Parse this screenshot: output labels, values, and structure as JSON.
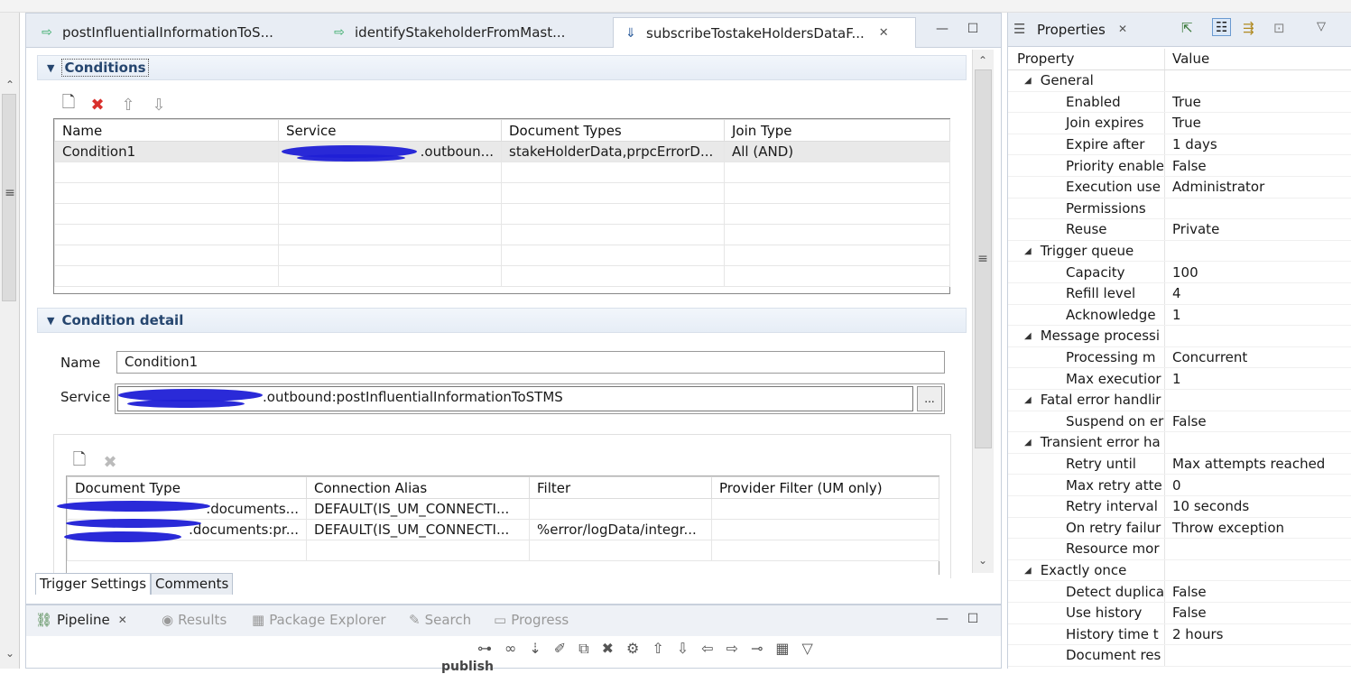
{
  "editor": {
    "tabs": [
      {
        "label": "postInfluentialInformationToS...",
        "icon": "service-arrow-icon"
      },
      {
        "label": "identifyStakeholderFromMast...",
        "icon": "service-arrow-icon"
      },
      {
        "label": "subscribeTostakeHoldersDataF...",
        "icon": "trigger-icon",
        "active": true,
        "close": "✕"
      }
    ],
    "conditions": {
      "title": "Conditions",
      "columns": [
        "Name",
        "Service",
        "Document Types",
        "Join Type"
      ],
      "rows": [
        {
          "name": "Condition1",
          "service": ".outboun...",
          "doc_types": "stakeHolderData,prpcErrorD...",
          "join": "All (AND)"
        }
      ]
    },
    "detail": {
      "title": "Condition detail",
      "name_label": "Name",
      "name_value": "Condition1",
      "service_label": "Service",
      "service_value": ".outbound:postInfluentialInformationToSTMS",
      "browse_label": "...",
      "columns": [
        "Document Type",
        "Connection Alias",
        "Filter",
        "Provider Filter (UM only)"
      ],
      "rows": [
        {
          "doc": ".documents...",
          "alias": "DEFAULT(IS_UM_CONNECTI...",
          "filter": "",
          "provider": ""
        },
        {
          "doc": ".documents:pr...",
          "alias": "DEFAULT(IS_UM_CONNECTI...",
          "filter": "%error/logData/integr...",
          "provider": ""
        }
      ]
    },
    "bottom_tabs": [
      "Trigger Settings",
      "Comments"
    ]
  },
  "pipeline": {
    "tabs": [
      {
        "label": "Pipeline",
        "active": true,
        "close": "✕"
      },
      {
        "label": "Results"
      },
      {
        "label": "Package Explorer"
      },
      {
        "label": "Search"
      },
      {
        "label": "Progress"
      }
    ],
    "partial_text": "publish"
  },
  "properties": {
    "title": "Properties",
    "close": "✕",
    "header": {
      "key": "Property",
      "value": "Value"
    },
    "rows": [
      {
        "type": "cat",
        "key": "General",
        "value": ""
      },
      {
        "type": "item",
        "key": "Enabled",
        "value": "True"
      },
      {
        "type": "item",
        "key": "Join expires",
        "value": "True"
      },
      {
        "type": "item",
        "key": "Expire after",
        "value": "1 days"
      },
      {
        "type": "item",
        "key": "Priority enable",
        "value": "False"
      },
      {
        "type": "item",
        "key": "Execution use",
        "value": "Administrator"
      },
      {
        "type": "item",
        "key": "Permissions",
        "value": ""
      },
      {
        "type": "item",
        "key": "Reuse",
        "value": "Private"
      },
      {
        "type": "cat",
        "key": "Trigger queue",
        "value": ""
      },
      {
        "type": "item",
        "key": "Capacity",
        "value": "100"
      },
      {
        "type": "item",
        "key": "Refill level",
        "value": "4"
      },
      {
        "type": "item",
        "key": "Acknowledge",
        "value": "1"
      },
      {
        "type": "cat",
        "key": "Message processi",
        "value": ""
      },
      {
        "type": "item",
        "key": "Processing m",
        "value": "Concurrent"
      },
      {
        "type": "item",
        "key": "Max executior",
        "value": "1"
      },
      {
        "type": "cat",
        "key": "Fatal error handlir",
        "value": ""
      },
      {
        "type": "item",
        "key": "Suspend on er",
        "value": "False"
      },
      {
        "type": "cat",
        "key": "Transient error ha",
        "value": ""
      },
      {
        "type": "item",
        "key": "Retry until",
        "value": "Max attempts reached"
      },
      {
        "type": "item",
        "key": "Max retry atte",
        "value": "0"
      },
      {
        "type": "item",
        "key": "Retry interval",
        "value": "10 seconds"
      },
      {
        "type": "item",
        "key": "On retry failur",
        "value": "Throw exception"
      },
      {
        "type": "item",
        "key": "Resource mor",
        "value": ""
      },
      {
        "type": "cat",
        "key": "Exactly once",
        "value": ""
      },
      {
        "type": "item",
        "key": "Detect duplica",
        "value": "False"
      },
      {
        "type": "item",
        "key": "Use history",
        "value": "False"
      },
      {
        "type": "item",
        "key": "History time t",
        "value": "2 hours"
      },
      {
        "type": "item",
        "key": "Document res",
        "value": ""
      }
    ]
  },
  "colors": {
    "accent": "#26466f",
    "delete": "#d9302c",
    "scribble": "#1f1fd6"
  }
}
